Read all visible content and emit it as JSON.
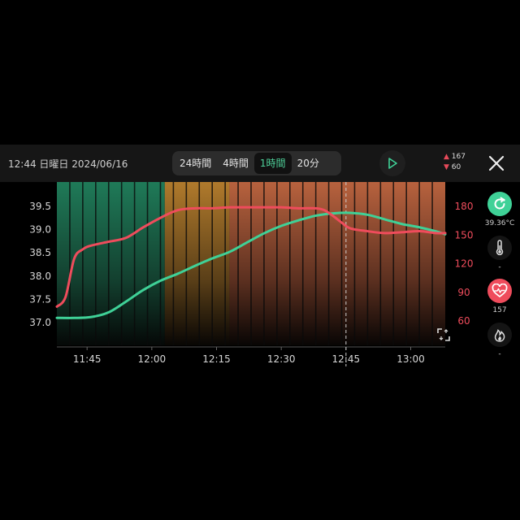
{
  "header": {
    "datetime": "12:44 日曜日 2024/06/16",
    "tabs": [
      {
        "label": "24時間",
        "active": false
      },
      {
        "label": "4時間",
        "active": false
      },
      {
        "label": "1時間",
        "active": true
      },
      {
        "label": "20分",
        "active": false
      }
    ],
    "hr_max": "167",
    "hr_min": "60"
  },
  "side_panel": {
    "temp_value": "39.36°C",
    "thermometer_value": "-",
    "heart_value": "157",
    "flame_value": "-"
  },
  "colors": {
    "temperature": "#3fd197",
    "heart_rate": "#ef4c5c",
    "accent": "#4fd39b"
  },
  "chart_data": {
    "type": "line",
    "x_ticks": [
      "11:45",
      "12:00",
      "12:15",
      "12:30",
      "12:45",
      "13:00"
    ],
    "x_tick_minutes": [
      705,
      720,
      735,
      750,
      765,
      780
    ],
    "xlim_minutes": [
      698,
      788
    ],
    "cursor_minute": 765,
    "y_left_ticks": [
      "39.5",
      "39.0",
      "38.5",
      "38.0",
      "37.5",
      "37.0"
    ],
    "y_left_range": [
      37.0,
      39.5
    ],
    "y_right_ticks": [
      "180",
      "150",
      "120",
      "90",
      "60"
    ],
    "y_right_range": [
      60,
      180
    ],
    "zones": [
      {
        "from": 698,
        "to": 723,
        "color": "green"
      },
      {
        "from": 723,
        "to": 738,
        "color": "amber"
      },
      {
        "from": 738,
        "to": 788,
        "color": "copper"
      }
    ],
    "series": [
      {
        "axis": "left",
        "x": [
          698,
          702,
          706,
          710,
          714,
          718,
          722,
          726,
          730,
          734,
          738,
          742,
          746,
          750,
          754,
          758,
          762,
          766,
          770,
          774,
          778,
          782,
          786,
          788
        ],
        "y": [
          37.1,
          37.1,
          37.12,
          37.22,
          37.45,
          37.7,
          37.9,
          38.05,
          38.22,
          38.38,
          38.52,
          38.72,
          38.92,
          39.08,
          39.2,
          39.3,
          39.35,
          39.36,
          39.32,
          39.22,
          39.12,
          39.05,
          38.96,
          38.9
        ]
      },
      {
        "axis": "right",
        "x": [
          698,
          700,
          702,
          704,
          706,
          710,
          714,
          718,
          722,
          726,
          730,
          734,
          738,
          742,
          746,
          750,
          754,
          758,
          760,
          762,
          764,
          766,
          770,
          774,
          778,
          782,
          786,
          788
        ],
        "y": [
          75,
          85,
          125,
          135,
          139,
          143,
          147,
          158,
          168,
          176,
          178,
          178,
          179,
          179,
          179,
          179,
          178,
          178,
          176,
          170,
          163,
          157,
          154,
          152,
          153,
          154,
          152,
          152
        ]
      }
    ]
  }
}
